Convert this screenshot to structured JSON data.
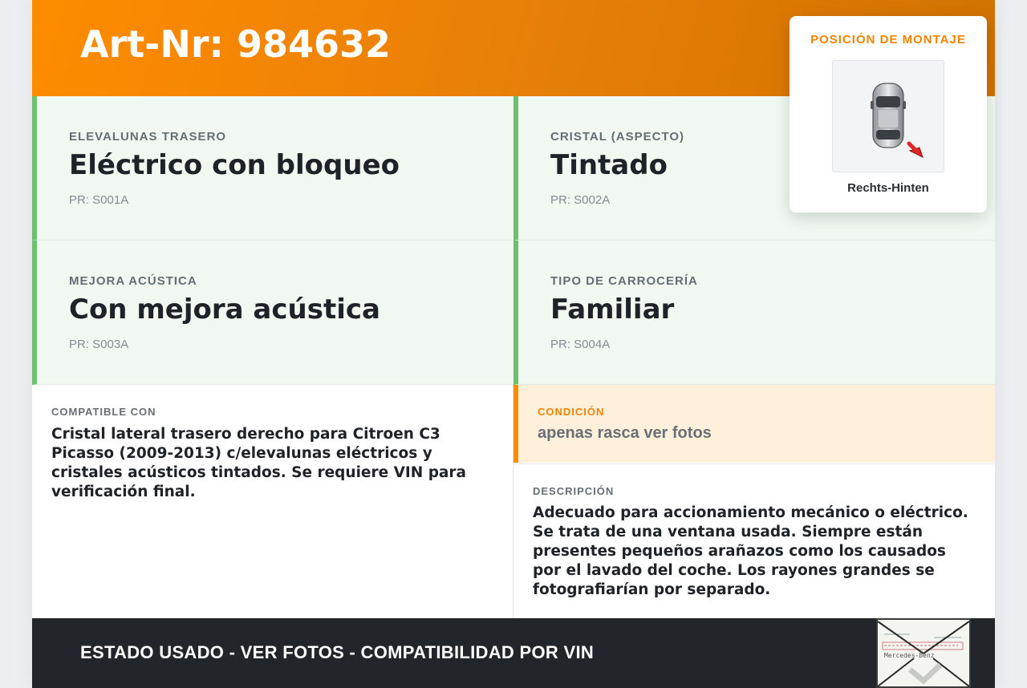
{
  "header": {
    "title": "Art-Nr: 984632"
  },
  "specs": [
    {
      "label": "ELEVALUNAS TRASERO",
      "value": "Eléctrico con bloqueo",
      "code": "PR: S001A"
    },
    {
      "label": "CRISTAL (ASPECTO)",
      "value": "Tintado",
      "code": "PR: S002A"
    },
    {
      "label": "MEJORA ACÚSTICA",
      "value": "Con mejora acústica",
      "code": "PR: S003A"
    },
    {
      "label": "TIPO DE CARROCERÍA",
      "value": "Familiar",
      "code": "PR: S004A"
    }
  ],
  "mounting": {
    "title": "POSICIÓN DE MONTAJE",
    "caption": "Rechts-Hinten",
    "icon": "car-top-view-icon",
    "arrow_color": "#e0262b"
  },
  "compatible": {
    "label": "COMPATIBLE CON",
    "text": "Cristal lateral trasero derecho para Citroen C3 Picasso (2009-2013) c/elevalunas eléctricos y cristales acústicos tintados. Se requiere VIN para verificación final."
  },
  "condition": {
    "label": "CONDICIÓN",
    "text": "apenas rasca ver fotos"
  },
  "description": {
    "label": "DESCRIPCIÓN",
    "text": "Adecuado para accionamiento mecánico o eléctrico. Se trata de una ventana usada. Siempre están presentes pequeños arañazos como los causados por el lavado del coche. Los rayones grandes se fotografiarían por separado."
  },
  "footer": {
    "text": "ESTADO USADO - VER FOTOS - COMPATIBILIDAD POR VIN",
    "stamp_text": "Mercedes-Benz"
  },
  "colors": {
    "accent": "#ff8c00",
    "green": "#6cc06e",
    "dark": "#22252a"
  }
}
